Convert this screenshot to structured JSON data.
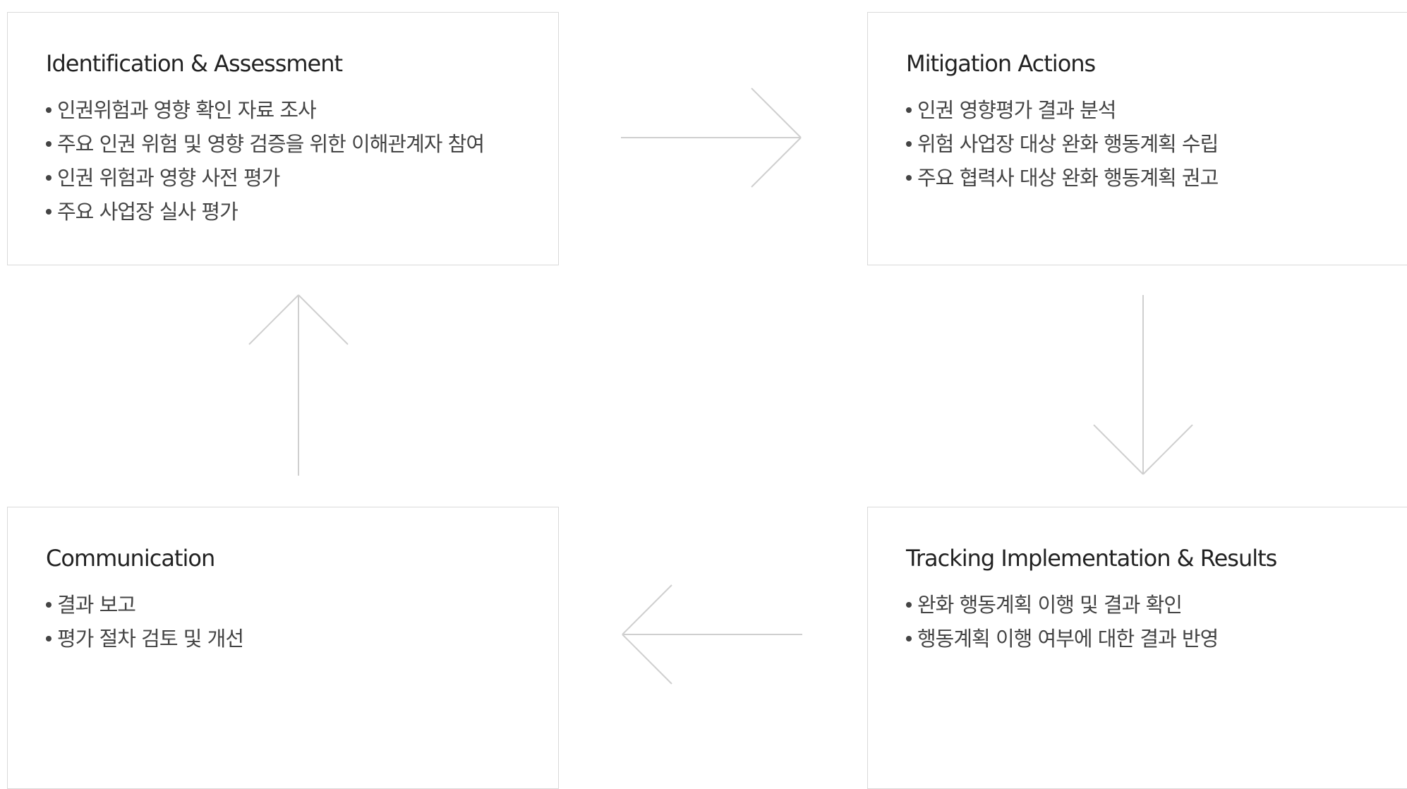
{
  "steps": {
    "identification": {
      "title": "Identification & Assessment",
      "items": [
        "인권위험과 영향 확인 자료 조사",
        "주요 인권 위험 및 영향 검증을 위한 이해관계자 참여",
        "인권 위험과 영향 사전 평가",
        "주요 사업장 실사 평가"
      ]
    },
    "mitigation": {
      "title": "Mitigation Actions",
      "items": [
        "인권 영향평가 결과 분석",
        "위험 사업장 대상 완화 행동계획 수립",
        "주요 협력사 대상 완화 행동계획 권고"
      ]
    },
    "communication": {
      "title": "Communication",
      "items": [
        "결과 보고",
        "평가 절차 검토 및 개선"
      ]
    },
    "tracking": {
      "title": "Tracking Implementation & Results",
      "items": [
        "완화 행동계획 이행 및 결과 확인",
        "행동계획 이행 여부에 대한 결과 반영"
      ]
    }
  },
  "colors": {
    "border": "#d9d9d9",
    "arrow": "#cfcfcf",
    "title": "#222222",
    "text": "#444444"
  },
  "arrows": [
    "right",
    "down",
    "left",
    "up"
  ]
}
